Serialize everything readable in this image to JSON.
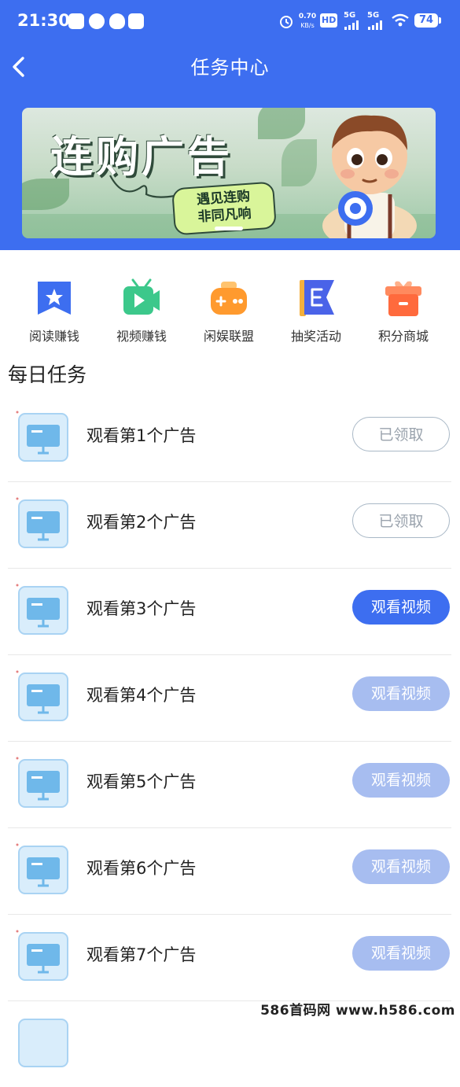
{
  "status_bar": {
    "time": "21:30",
    "speed_value": "0.70",
    "speed_unit": "KB/s",
    "hd": "HD",
    "signal1": "5G",
    "signal2": "5G",
    "battery": "74"
  },
  "header": {
    "title": "任务中心",
    "back_icon": "chevron-left-icon"
  },
  "banner": {
    "title": "连购广告",
    "slogan_line1": "遇见连购",
    "slogan_line2": "非同凡响"
  },
  "quick_nav": [
    {
      "label": "阅读赚钱",
      "icon": "bookmark-star-icon",
      "color": "#3d6ef0"
    },
    {
      "label": "视频赚钱",
      "icon": "video-play-icon",
      "color": "#3cc88b"
    },
    {
      "label": "闲娱联盟",
      "icon": "gamepad-icon",
      "color": "#ff9a2e"
    },
    {
      "label": "抽奖活动",
      "icon": "flag-icon",
      "color": "#4a63e8"
    },
    {
      "label": "积分商城",
      "icon": "gift-icon",
      "color": "#ff6a3d"
    }
  ],
  "section_title": "每日任务",
  "tasks": [
    {
      "label": "观看第1个广告",
      "button": "已领取",
      "state": "claimed"
    },
    {
      "label": "观看第2个广告",
      "button": "已领取",
      "state": "claimed"
    },
    {
      "label": "观看第3个广告",
      "button": "观看视频",
      "state": "active"
    },
    {
      "label": "观看第4个广告",
      "button": "观看视频",
      "state": "inactive"
    },
    {
      "label": "观看第5个广告",
      "button": "观看视频",
      "state": "inactive"
    },
    {
      "label": "观看第6个广告",
      "button": "观看视频",
      "state": "inactive"
    },
    {
      "label": "观看第7个广告",
      "button": "观看视频",
      "state": "inactive"
    }
  ],
  "watermark": "586首码网 www.h586.com",
  "colors": {
    "brand_blue": "#3d6ef0",
    "inactive_blue": "#a7bdf0"
  }
}
